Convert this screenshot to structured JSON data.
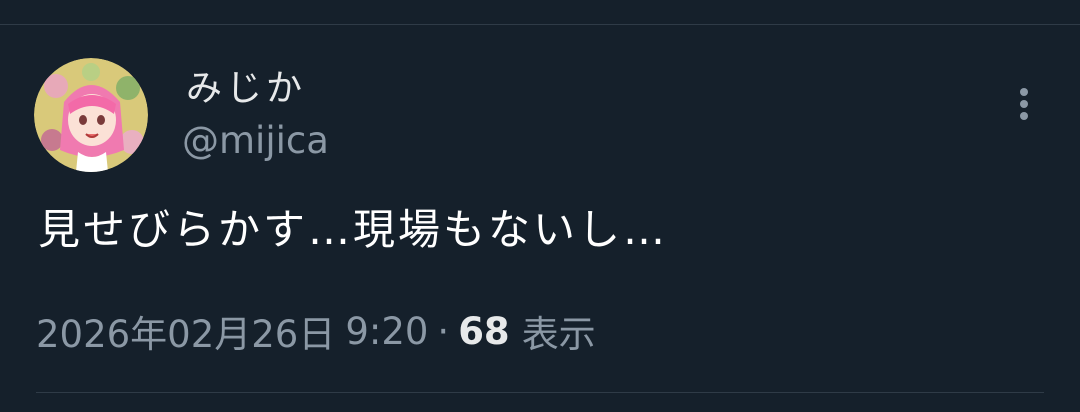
{
  "tweet": {
    "display_name": "みじか",
    "handle": "@mijica",
    "text": "見せびらかす…現場もないし…",
    "date": "2026年02月26日",
    "time": "9:20",
    "separator": "·",
    "view_count": "68",
    "view_label": "表示"
  },
  "icons": {
    "avatar": "avatar-image",
    "more": "more-vertical-icon"
  },
  "colors": {
    "background": "#15202b",
    "primary_text": "#e7e9ea",
    "secondary_text": "#8b98a5",
    "divider": "#2f3b47"
  }
}
